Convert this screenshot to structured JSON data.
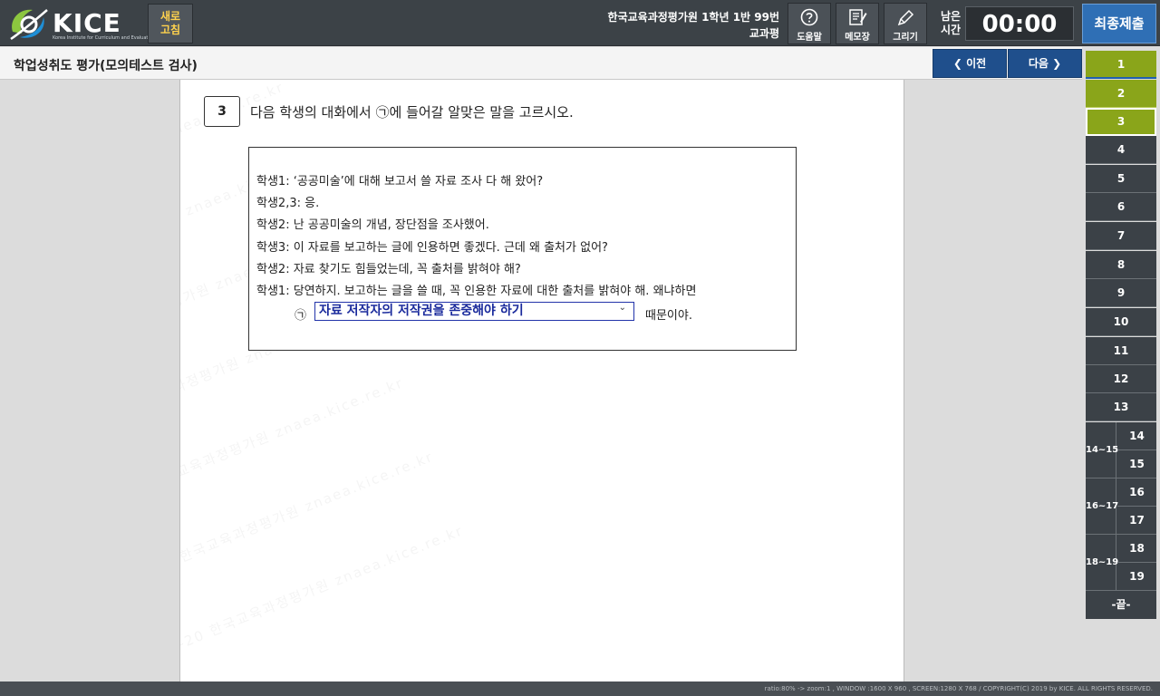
{
  "header": {
    "logo_text": "KICE",
    "logo_subtext": "Korea Institute for Curriculum and Evaluation",
    "refresh_line1": "새로",
    "refresh_line2": "고침",
    "student_line1": "한국교육과정평가원 1학년 1반 99번",
    "student_line2": "교과평",
    "tools": [
      {
        "label": "도움말",
        "icon": "help-icon"
      },
      {
        "label": "메모장",
        "icon": "memo-icon"
      },
      {
        "label": "그리기",
        "icon": "pen-icon"
      }
    ],
    "timer_label_line1": "남은",
    "timer_label_line2": "시간",
    "timer_value": "00:00",
    "submit_label": "최종제출"
  },
  "titlebar": {
    "title": "학업성취도 평가(모의테스트 검사)",
    "prev_label": "이전",
    "next_label": "다음"
  },
  "question": {
    "number": "3",
    "prompt": "다음 학생의 대화에서 ㉠에 들어갈 알맞은 말을 고르시오.",
    "dialog": [
      "학생1: ‘공공미술’에 대해 보고서 쓸 자료 조사 다 해 왔어?",
      "학생2,3: 응.",
      "학생2: 난 공공미술의 개념, 장단점을 조사했어.",
      "학생3: 이 자료를 보고하는 글에 인용하면 좋겠다. 근데 왜 출처가 없어?",
      "학생2: 자료 찾기도 힘들었는데, 꼭 출처를 밝혀야 해?",
      "학생1: 당연하지. 보고하는 글을 쓸 때, 꼭 인용한 자료에 대한 출처를 밝혀야 해. 왜냐하면"
    ],
    "answer_mark": "㉠",
    "answer_selected": "자료 저작자의 저작권을 존중해야 하기",
    "answer_tail": "때문이야."
  },
  "watermark": "2023-07-20 한국교육과정평가원 znaea.kice.re.kr",
  "question_panel": {
    "items": [
      "1",
      "2",
      "3",
      "4",
      "5",
      "6",
      "7",
      "8",
      "9",
      "10",
      "11",
      "12",
      "13"
    ],
    "groups": [
      {
        "label": "14~15",
        "items": [
          "14",
          "15"
        ]
      },
      {
        "label": "16~17",
        "items": [
          "16",
          "17"
        ]
      },
      {
        "label": "18~19",
        "items": [
          "18",
          "19"
        ]
      }
    ],
    "end_label": "-끝-",
    "status": {
      "answered": [
        "1",
        "2",
        "3"
      ],
      "current": "3"
    }
  },
  "footer": {
    "text": "ratio:80% -> zoom:1 , WINDOW :1600 X 960 , SCREEN:1280 X 768 / COPYRIGHT(C) 2019 by KICE. ALL RIGHTS RESERVED."
  },
  "colors": {
    "topbar": "#3c4247",
    "submit": "#2f6fb5",
    "nav": "#1f4f8c",
    "answered": "#8aa51a",
    "unanswered": "#3b4147",
    "answer_text": "#1a2a9c"
  }
}
